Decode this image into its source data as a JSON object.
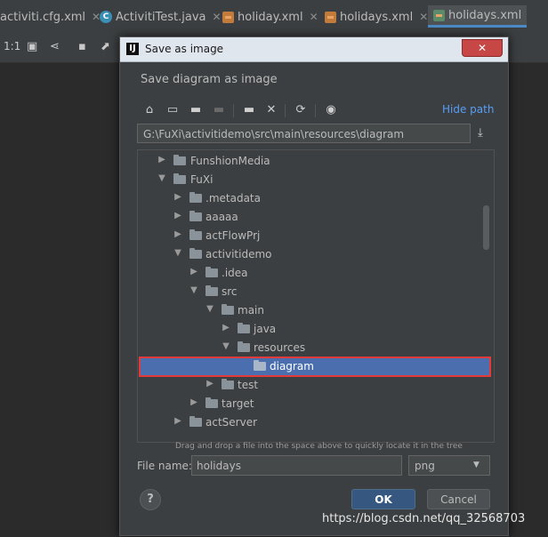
{
  "editor_tabs": [
    {
      "label": "activiti.cfg.xml",
      "icon": "xml-file-icon"
    },
    {
      "label": "ActivitiTest.java",
      "icon": "java-class-icon"
    },
    {
      "label": "holiday.xml",
      "icon": "xml-file-icon"
    },
    {
      "label": "holidays.xml",
      "icon": "xml-file-icon"
    },
    {
      "label": "holidays.xml",
      "icon": "bpmn-file-icon",
      "active": true
    }
  ],
  "editor_toolbar": {
    "zoom_label": "1:1"
  },
  "dialog": {
    "title": "Save as image",
    "subtitle": "Save diagram as image",
    "hide_path_label": "Hide path",
    "path": "G:\\FuXi\\activitidemo\\src\\main\\resources\\diagram",
    "tree": [
      {
        "label": "FunshionMedia",
        "expanded": false
      },
      {
        "label": "FuXi",
        "expanded": true
      },
      {
        "label": ".metadata",
        "expanded": false
      },
      {
        "label": "aaaaa",
        "expanded": false
      },
      {
        "label": "actFlowPrj",
        "expanded": false
      },
      {
        "label": "activitidemo",
        "expanded": true
      },
      {
        "label": ".idea",
        "expanded": false
      },
      {
        "label": "src",
        "expanded": true
      },
      {
        "label": "main",
        "expanded": true
      },
      {
        "label": "java",
        "expanded": false
      },
      {
        "label": "resources",
        "expanded": true
      },
      {
        "label": "diagram",
        "selected": true
      },
      {
        "label": "test",
        "expanded": false
      },
      {
        "label": "target",
        "expanded": false
      },
      {
        "label": "actServer",
        "expanded": false
      }
    ],
    "drag_hint": "Drag and drop a file into the space above to quickly locate it in the tree",
    "file_name_label": "File name:",
    "file_name_value": "holidays",
    "format_value": "png",
    "ok_label": "OK",
    "cancel_label": "Cancel",
    "help_label": "?",
    "close_label": "✕"
  },
  "watermark": "https://blog.csdn.net/qq_32568703"
}
